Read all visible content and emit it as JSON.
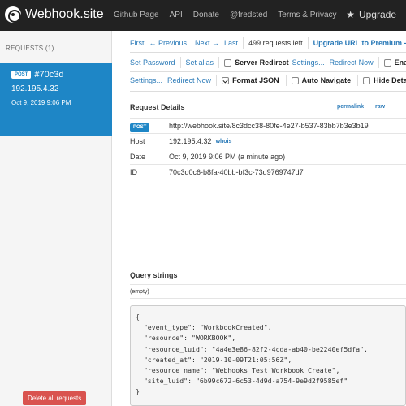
{
  "navbar": {
    "brand": "Webhook.site",
    "links": [
      "Github Page",
      "API",
      "Donate",
      "@fredsted",
      "Terms & Privacy"
    ],
    "upgrade": "Upgrade"
  },
  "sidebar": {
    "heading": "REQUESTS (1)",
    "request": {
      "method": "POST",
      "id": "#70c3d",
      "ip": "192.195.4.32",
      "date": "Oct 9, 2019 9:06 PM"
    },
    "delete_label": "Delete all requests"
  },
  "toolbar": {
    "first": "First",
    "previous": "← Previous",
    "next": "Next →",
    "last": "Last",
    "requests_left": "499 requests left",
    "upgrade_url": "Upgrade URL to Premium - I",
    "set_password": "Set Password",
    "set_alias": "Set alias",
    "server_redirect": "Server Redirect",
    "settings_dots": "Settings...",
    "redirect_now": "Redirect Now",
    "ena": "Ena",
    "settings2": "Settings...",
    "redirect_now2": "Redirect Now",
    "format_json": "Format JSON",
    "format_json_checked": true,
    "auto_navigate": "Auto Navigate",
    "hide_details": "Hide Details"
  },
  "details": {
    "title": "Request Details",
    "permalink": "permalink",
    "raw": "raw",
    "method": "POST",
    "url": "http://webhook.site/8c3dcc38-80fe-4e27-b537-83bb7b3e3b19",
    "host_label": "Host",
    "host": "192.195.4.32",
    "whois": "whois",
    "date_label": "Date",
    "date": "Oct 9, 2019 9:06 PM (a minute ago)",
    "id_label": "ID",
    "id": "70c3d0c6-b8fa-40bb-bf3c-73d9769747d7"
  },
  "query": {
    "title": "Query strings",
    "empty": "(empty)"
  },
  "body_lines": [
    "{",
    "  \"event_type\": \"WorkbookCreated\",",
    "  \"resource\": \"WORKBOOK\",",
    "  \"resource_luid\": \"4a4e3e86-82f2-4cda-ab40-be2240ef5dfa\",",
    "  \"created_at\": \"2019-10-09T21:05:56Z\",",
    "  \"resource_name\": \"Webhooks Test Workbook Create\",",
    "  \"site_luid\": \"6b99c672-6c53-4d9d-a754-9e9d2f9585ef\"",
    "}"
  ]
}
